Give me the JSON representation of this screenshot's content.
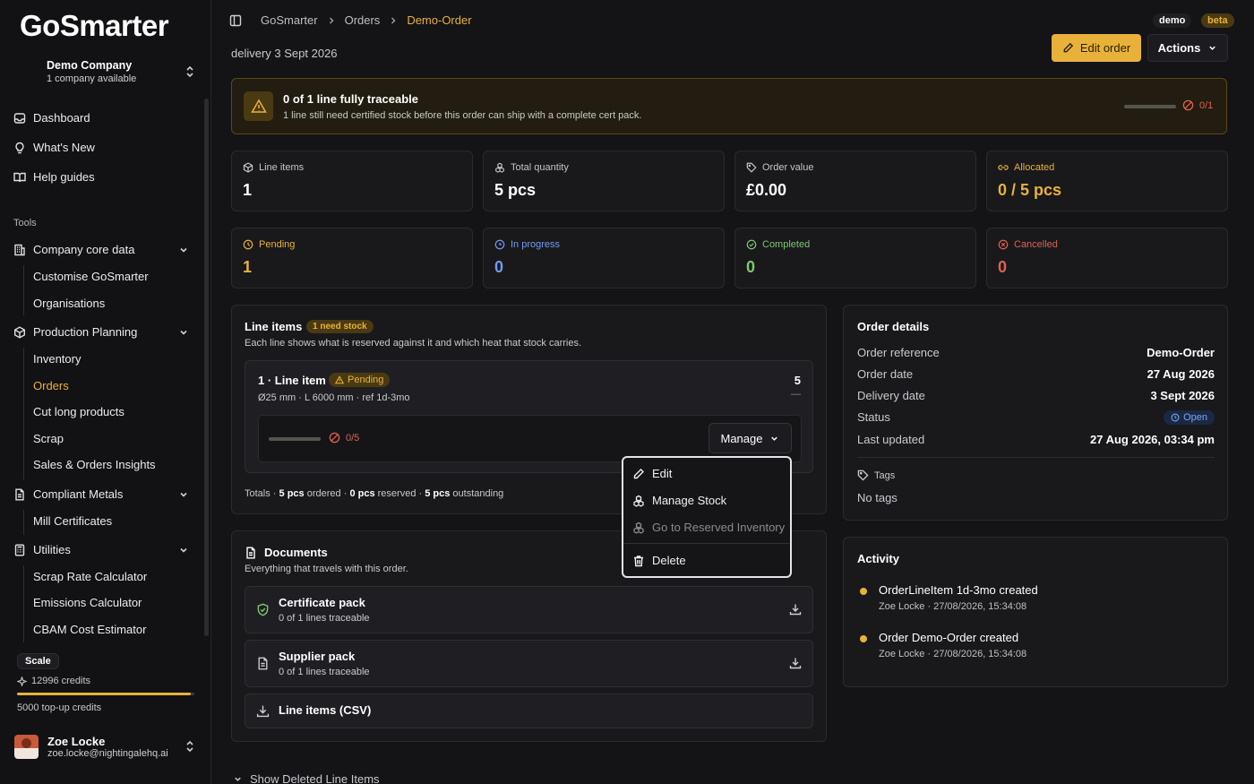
{
  "app": {
    "logo": "GoSmarter"
  },
  "company": {
    "name": "Demo Company",
    "subtitle": "1 company available"
  },
  "nav_top": [
    {
      "label": "Dashboard",
      "icon": "inbox-icon"
    },
    {
      "label": "What's New",
      "icon": "lightbulb-icon"
    },
    {
      "label": "Help guides",
      "icon": "book-icon"
    }
  ],
  "tools_label": "Tools",
  "groups": {
    "company": {
      "label": "Company core data",
      "items": [
        "Customise GoSmarter",
        "Organisations"
      ]
    },
    "production": {
      "label": "Production Planning",
      "items": [
        "Inventory",
        "Orders",
        "Cut long products",
        "Scrap",
        "Sales & Orders Insights"
      ]
    },
    "metals": {
      "label": "Compliant Metals",
      "items": [
        "Mill Certificates"
      ]
    },
    "utilities": {
      "label": "Utilities",
      "items": [
        "Scrap Rate Calculator",
        "Emissions Calculator",
        "CBAM Cost Estimator"
      ]
    }
  },
  "plan": {
    "name": "Scale",
    "credits": "12996 credits",
    "credit_fraction": 0.98,
    "topup": "5000 top-up credits"
  },
  "user": {
    "name": "Zoe Locke",
    "email": "zoe.locke@nightingalehq.ai"
  },
  "breadcrumb": [
    "GoSmarter",
    "Orders",
    "Demo-Order"
  ],
  "header": {
    "delivery": "delivery 3 Sept 2026",
    "badge_demo": "demo",
    "badge_beta": "beta",
    "edit_order": "Edit order",
    "actions": "Actions"
  },
  "alert": {
    "title": "0 of 1 line fully traceable",
    "description": "1 line still need certified stock before this order can ship with a complete cert pack.",
    "count": "0/1",
    "fraction": 0
  },
  "stats": [
    {
      "label": "Line items",
      "value": "1",
      "icon": "cube-icon"
    },
    {
      "label": "Total quantity",
      "value": "5 pcs",
      "icon": "boxes-icon"
    },
    {
      "label": "Order value",
      "value": "£0.00",
      "icon": "tag-icon"
    },
    {
      "label": "Allocated",
      "value": "0 / 5 pcs",
      "icon": "link-icon"
    }
  ],
  "statuses": [
    {
      "label": "Pending",
      "value": "1",
      "color": "#e8b23a",
      "icon": "clock-icon"
    },
    {
      "label": "In progress",
      "value": "0",
      "color": "#6f9cf0",
      "icon": "progress-icon"
    },
    {
      "label": "Completed",
      "value": "0",
      "color": "#7cc86f",
      "icon": "check-circle-icon"
    },
    {
      "label": "Cancelled",
      "value": "0",
      "color": "#e0604e",
      "icon": "x-circle-icon"
    }
  ],
  "line_items": {
    "title": "Line items",
    "badge": "1 need stock",
    "description": "Each line shows what is reserved against it and which heat that stock carries.",
    "item": {
      "title": "1 · Line item",
      "status": "Pending",
      "spec": "Ø25 mm · L 6000 mm · ref 1d-3mo",
      "qty": "5",
      "dash": "—",
      "count": "0/5",
      "fraction": 0,
      "manage": "Manage"
    },
    "totals": {
      "ordered": "5 pcs",
      "ordered_lbl": "ordered",
      "reserved": "0 pcs",
      "reserved_lbl": "reserved",
      "outstanding": "5 pcs",
      "outstanding_lbl": "outstanding",
      "prefix": "Totals ·"
    }
  },
  "menu": {
    "edit": "Edit",
    "manage_stock": "Manage Stock",
    "go_reserved": "Go to Reserved Inventory",
    "delete": "Delete"
  },
  "documents": {
    "title": "Documents",
    "description": "Everything that travels with this order.",
    "cert": {
      "title": "Certificate pack",
      "sub": "0 of 1 lines traceable"
    },
    "supplier": {
      "title": "Supplier pack",
      "sub": "0 of 1 lines traceable"
    },
    "csv": {
      "title": "Line items (CSV)"
    }
  },
  "order_details": {
    "title": "Order details",
    "rows": [
      {
        "k": "Order reference",
        "v": "Demo-Order"
      },
      {
        "k": "Order date",
        "v": "27 Aug 2026"
      },
      {
        "k": "Delivery date",
        "v": "3 Sept 2026"
      },
      {
        "k": "Status",
        "v": "Open"
      },
      {
        "k": "Last updated",
        "v": "27 Aug 2026, 03:34 pm"
      }
    ],
    "tags_label": "Tags",
    "tags_value": "No tags"
  },
  "activity": {
    "title": "Activity",
    "items": [
      {
        "text": "OrderLineItem 1d-3mo created",
        "meta": "Zoe Locke · 27/08/2026, 15:34:08"
      },
      {
        "text": "Order Demo-Order created",
        "meta": "Zoe Locke · 27/08/2026, 15:34:08"
      }
    ]
  },
  "show_deleted": "Show Deleted Line Items"
}
